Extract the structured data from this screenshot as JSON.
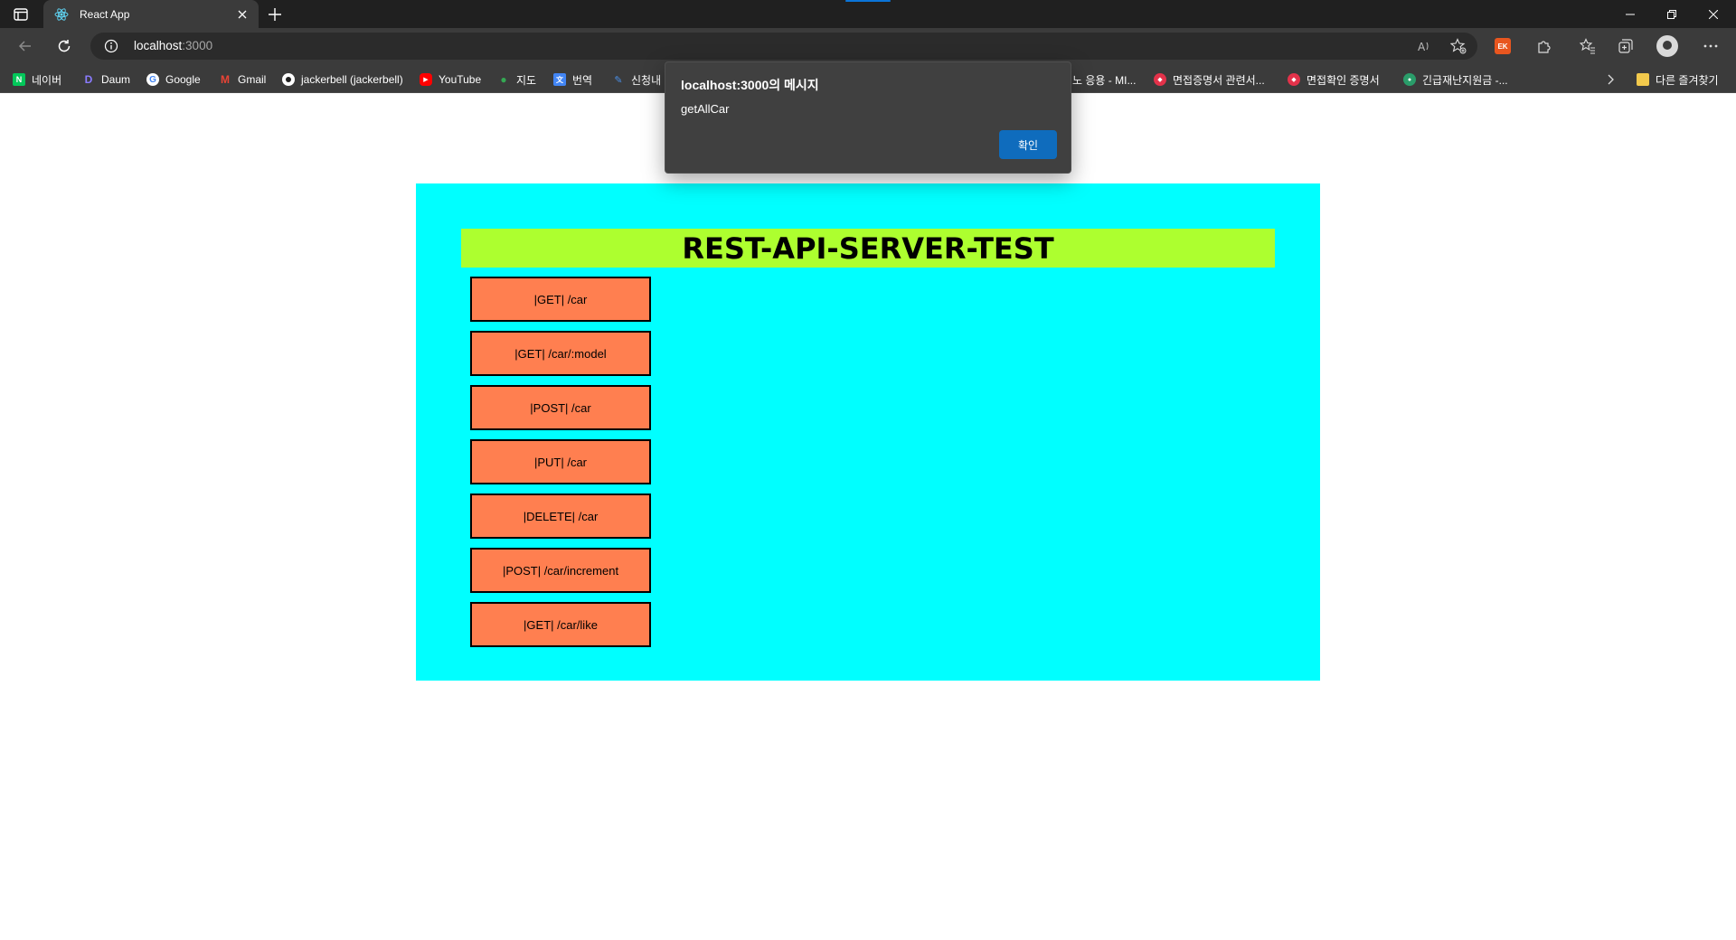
{
  "browser": {
    "tab_title": "React App",
    "address_host": "localhost",
    "address_port": ":3000",
    "profile_badge": "EK",
    "bookmarks": [
      {
        "label": "네이버",
        "color": "#03c75a",
        "glyph": "N"
      },
      {
        "label": "Daum",
        "color": "#5a6dff",
        "glyph": "D"
      },
      {
        "label": "Google",
        "color": "#ffffff",
        "glyph": "G"
      },
      {
        "label": "Gmail",
        "color": "#ea4335",
        "glyph": "M"
      },
      {
        "label": "jackerbell (jackerbell)",
        "color": "#ffffff",
        "glyph": "◉"
      },
      {
        "label": "YouTube",
        "color": "#ff0000",
        "glyph": "▶"
      },
      {
        "label": "지도",
        "color": "#34a853",
        "glyph": "●"
      },
      {
        "label": "번역",
        "color": "#4285f4",
        "glyph": "文"
      },
      {
        "label": "신청내",
        "color": "#4a8fe7",
        "glyph": "✎"
      },
      {
        "label": "노 응용 - MI...",
        "color": "",
        "glyph": ""
      },
      {
        "label": "면접증명서 관련서...",
        "color": "#e3324a",
        "glyph": "◆"
      },
      {
        "label": "면접확인 증명서",
        "color": "#e3324a",
        "glyph": "◆"
      },
      {
        "label": "긴급재난지원금 -...",
        "color": "#2a9d6a",
        "glyph": "●"
      }
    ],
    "other_bookmarks": "다른 즐겨찾기"
  },
  "dialog": {
    "title": "localhost:3000의 메시지",
    "message": "getAllCar",
    "ok_label": "확인"
  },
  "page": {
    "heading": "REST-API-SERVER-TEST",
    "buttons": [
      {
        "label": "|GET| /car"
      },
      {
        "label": "|GET| /car/:model"
      },
      {
        "label": "|POST| /car"
      },
      {
        "label": "|PUT| /car"
      },
      {
        "label": "|DELETE| /car"
      },
      {
        "label": "|POST| /car/increment"
      },
      {
        "label": "|GET| /car/like"
      }
    ]
  },
  "colors": {
    "panel": "#00ffff",
    "heading_bg": "#adff2f",
    "button_bg": "#ff7f50",
    "dialog_ok": "#0f6cbd"
  }
}
